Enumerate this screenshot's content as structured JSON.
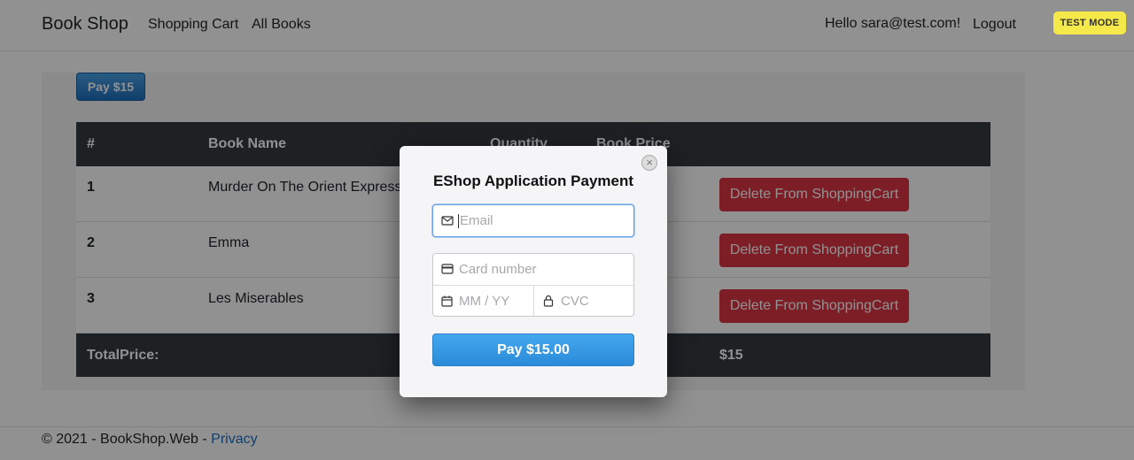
{
  "nav": {
    "brand": "Book Shop",
    "links": [
      "Shopping Cart",
      "All Books"
    ],
    "greeting": "Hello sara@test.com!",
    "logout": "Logout"
  },
  "cart": {
    "pay_button": "Pay $15",
    "columns": [
      "#",
      "Book Name",
      "Quantity",
      "Book Price"
    ],
    "rows": [
      {
        "num": "1",
        "name": "Murder On The Orient Express",
        "action": "Delete From ShoppingCart"
      },
      {
        "num": "2",
        "name": "Emma",
        "action": "Delete From ShoppingCart"
      },
      {
        "num": "3",
        "name": "Les Miserables",
        "action": "Delete From ShoppingCart"
      }
    ],
    "total_label": "TotalPrice:",
    "total_value": "$15"
  },
  "footer": {
    "text": "© 2021 - BookShop.Web - ",
    "privacy": "Privacy"
  },
  "badge": "TEST MODE",
  "modal": {
    "title": "EShop Application Payment",
    "close": "×",
    "email_placeholder": "Email",
    "card_placeholder": "Card number",
    "expiry_placeholder": "MM / YY",
    "cvc_placeholder": "CVC",
    "pay_label": "Pay $15.00"
  },
  "colors": {
    "danger": "#dc3545",
    "dark": "#343a40",
    "primary": "#2a8ad8",
    "badge": "#f5e84b"
  }
}
